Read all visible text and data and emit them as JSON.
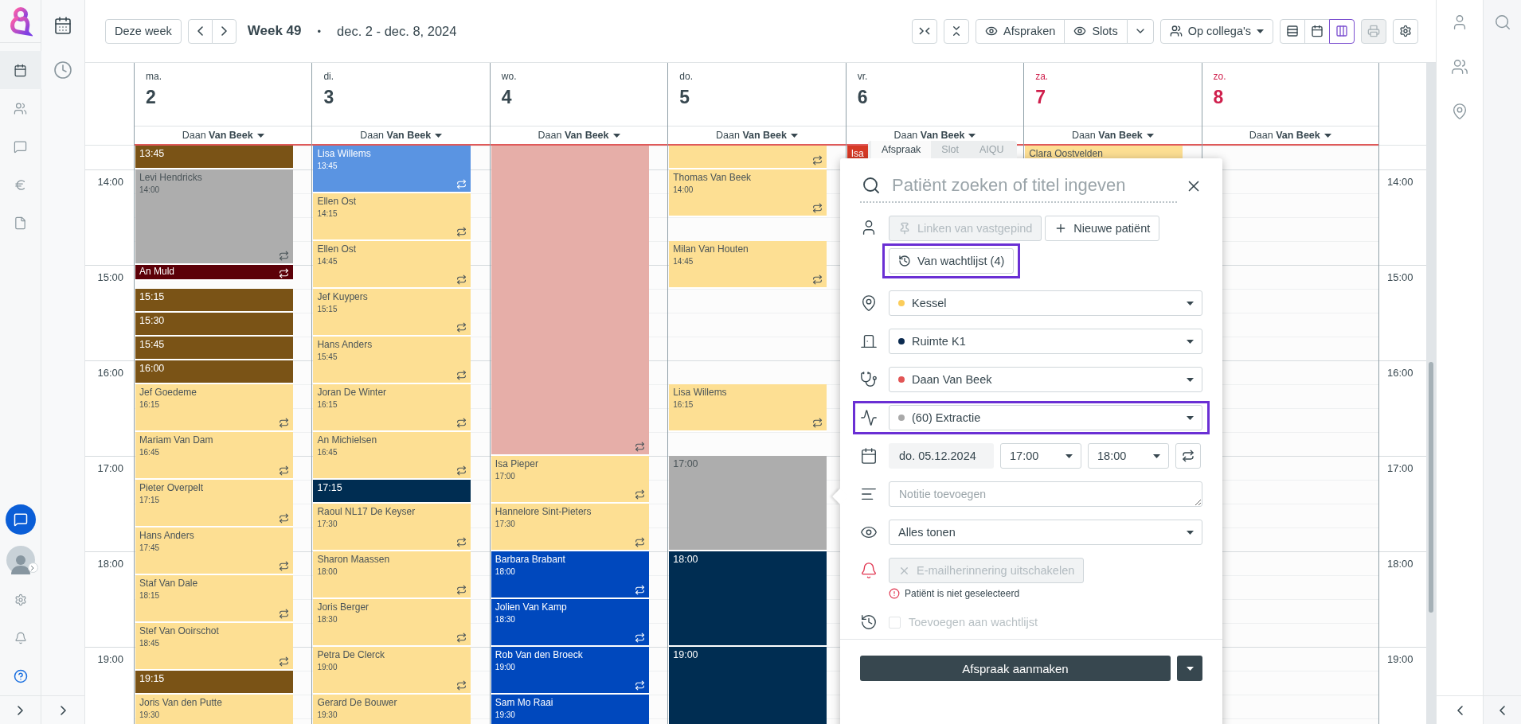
{
  "nav": {
    "items": [
      {
        "selected": true
      },
      {
        "selected": false
      },
      {
        "selected": false
      },
      {
        "selected": false
      },
      {
        "selected": false
      }
    ]
  },
  "subnav": {
    "items": [
      {
        "selected": true
      },
      {
        "selected": false
      }
    ]
  },
  "toolbar": {
    "today": "Deze week",
    "week": "Week 49",
    "separator": "•",
    "range": "dec. 2 - dec. 8, 2024",
    "show_toggles": [
      {
        "label": "Afspraken",
        "on": true
      },
      {
        "label": "Slots",
        "on": true
      }
    ],
    "colleagues": "Op collega's",
    "views": [
      {
        "selected": false
      },
      {
        "selected": false
      },
      {
        "selected": true
      }
    ],
    "print_disabled": true
  },
  "times_left": [
    "14:00",
    "15:00",
    "16:00",
    "17:00",
    "18:00",
    "19:00"
  ],
  "times_right": [
    "14:00",
    "15:00",
    "16:00",
    "17:00",
    "18:00",
    "19:00"
  ],
  "days": [
    {
      "name": "ma.",
      "date": "2",
      "weekend": false,
      "doctor": "Daan **Van Beek**",
      "events": [
        {
          "kind": "quarter-block",
          "time": "13:45",
          "color": "#7a5316",
          "repeat": false
        },
        {
          "kind": "hour-appointment",
          "name": "Levi Hendricks",
          "time": "14:00",
          "color": "#adadad",
          "repeat": true
        },
        {
          "kind": "short-appointment",
          "name": "An Muld",
          "color": "#5c0008",
          "repeat": true
        },
        {
          "kind": "quarter-block",
          "time": "15:15",
          "color": "#7a5316",
          "repeat": false
        },
        {
          "kind": "quarter-block",
          "time": "15:30",
          "color": "#7a5316",
          "repeat": false
        },
        {
          "kind": "quarter-block",
          "time": "15:45",
          "color": "#7a5316",
          "repeat": false
        },
        {
          "kind": "quarter-block",
          "time": "16:00",
          "color": "#7a5316",
          "repeat": false
        },
        {
          "kind": "appointment",
          "name": "Jef Goedeme",
          "time": "16:15",
          "color": "#fddf93",
          "repeat": true
        },
        {
          "kind": "appointment",
          "name": "Mariam Van Dam",
          "time": "16:45",
          "color": "#fddf93",
          "repeat": true
        },
        {
          "kind": "appointment",
          "name": "Pieter Overpelt",
          "time": "17:15",
          "color": "#fddf93",
          "repeat": true
        },
        {
          "kind": "appointment",
          "name": "Hans Anders",
          "time": "17:45",
          "color": "#fddf93",
          "repeat": true
        },
        {
          "kind": "appointment",
          "name": "Staf Van Dale",
          "time": "18:15",
          "color": "#fddf93",
          "repeat": true
        },
        {
          "kind": "appointment",
          "name": "Stef Van Ooirschot",
          "time": "18:45",
          "color": "#fddf93",
          "repeat": true
        },
        {
          "kind": "quarter-block",
          "time": "19:15",
          "color": "#7a5316",
          "repeat": false
        },
        {
          "kind": "appointment",
          "name": "Joris Van den Putte",
          "time": "19:30",
          "color": "#fddf93"
        }
      ]
    },
    {
      "name": "di.",
      "date": "3",
      "weekend": false,
      "doctor": "Daan **Van Beek**",
      "events": [
        {
          "kind": "appointment",
          "name": "Lisa Willems",
          "time": "13:45",
          "color": "#5a94e2",
          "repeat": true
        },
        {
          "kind": "appointment",
          "name": "Ellen Ost",
          "time": "14:15",
          "color": "#fddf93",
          "repeat": true
        },
        {
          "kind": "appointment",
          "name": "Ellen Ost",
          "time": "14:45",
          "color": "#fddf93",
          "repeat": true
        },
        {
          "kind": "appointment",
          "name": "Jef Kuypers",
          "time": "15:15",
          "color": "#fddf93",
          "repeat": true
        },
        {
          "kind": "appointment",
          "name": "Hans Anders",
          "time": "15:45",
          "color": "#fddf93",
          "repeat": true
        },
        {
          "kind": "appointment",
          "name": "Joran De Winter",
          "time": "16:15",
          "color": "#fddf93",
          "repeat": true
        },
        {
          "kind": "appointment",
          "name": "An Michielsen",
          "time": "16:45",
          "color": "#fddf93",
          "repeat": true
        },
        {
          "kind": "quarter-block",
          "time": "17:15",
          "color": "#002d52",
          "repeat": false
        },
        {
          "kind": "appointment",
          "name": "Raoul NL17 De Keyser",
          "time": "17:30",
          "color": "#fddf93",
          "repeat": true
        },
        {
          "kind": "appointment",
          "name": "Sharon Maassen",
          "time": "18:00",
          "color": "#fddf93",
          "repeat": true
        },
        {
          "kind": "appointment",
          "name": "Joris Berger",
          "time": "18:30",
          "color": "#fddf93",
          "repeat": true
        },
        {
          "kind": "appointment",
          "name": "Petra De Clerck",
          "time": "19:00",
          "color": "#fddf93",
          "repeat": true
        },
        {
          "kind": "appointment",
          "name": "Gerard De Bouwer",
          "time": "19:30",
          "color": "#fddf93"
        }
      ]
    },
    {
      "name": "wo.",
      "date": "4",
      "weekend": false,
      "doctor": "Daan **Van Beek**",
      "events": [
        {
          "kind": "reserved",
          "color": "#e6aea8",
          "repeat": true
        },
        {
          "kind": "appointment",
          "name": "Isa Pieper",
          "time": "17:00",
          "color": "#fddf93",
          "repeat": true
        },
        {
          "kind": "appointment",
          "name": "Hannelore Sint-Pieters",
          "time": "17:30",
          "color": "#fddf93",
          "repeat": true
        },
        {
          "kind": "appointment",
          "name": "Barbara Brabant",
          "time": "18:00",
          "color": "#0048bd",
          "repeat": true
        },
        {
          "kind": "appointment",
          "name": "Jolien Van Kamp",
          "time": "18:30",
          "color": "#0048bd",
          "repeat": true
        },
        {
          "kind": "appointment",
          "name": "Rob Van den Broeck",
          "time": "19:00",
          "color": "#0048bd",
          "repeat": true
        },
        {
          "kind": "appointment",
          "name": "Sam Mo Raai",
          "time": "19:30",
          "color": "#0048bd"
        }
      ]
    },
    {
      "name": "do.",
      "date": "5",
      "weekend": false,
      "doctor": "Daan **Van Beek**",
      "events": [
        {
          "kind": "quarter-appointment",
          "color": "#fddf93",
          "repeat": true
        },
        {
          "kind": "appointment",
          "name": "Thomas Van Beek",
          "time": "14:00",
          "color": "#fddf93",
          "repeat": true
        },
        {
          "kind": "gap"
        },
        {
          "kind": "appointment",
          "name": "Milan Van Houten",
          "time": "14:45",
          "color": "#fddf93",
          "repeat": true
        },
        {
          "kind": "hour-gap"
        },
        {
          "kind": "appointment",
          "name": "Lisa Willems",
          "time": "16:15",
          "color": "#fddf93",
          "repeat": true
        },
        {
          "kind": "gap"
        },
        {
          "kind": "hour-block",
          "time": "17:00",
          "color": "#adadad",
          "repeat": false
        },
        {
          "kind": "hour-block",
          "time": "18:00",
          "color": "#002d52",
          "repeat": false
        },
        {
          "kind": "hour-block",
          "time": "19:00",
          "color": "#002d52"
        }
      ]
    },
    {
      "name": "vr.",
      "date": "6",
      "weekend": false,
      "doctor": "Daan **Van Beek**",
      "events": [
        {
          "kind": "appointment",
          "name": "Isa",
          "color": "#d63a26"
        }
      ]
    },
    {
      "name": "za.",
      "date": "7",
      "weekend": true,
      "doctor": "Daan **Van Beek**",
      "events": [
        {
          "kind": "appointment",
          "name": "Clara Oostvelden",
          "color": "#fddf93"
        }
      ]
    },
    {
      "name": "zo.",
      "date": "8",
      "weekend": true,
      "doctor": "Daan **Van Beek**"
    }
  ],
  "popup": {
    "tabs": [
      {
        "label": "Afspraak",
        "selected": true
      },
      {
        "label": "Slot",
        "selected": false
      },
      {
        "label": "AIQU",
        "selected": false
      }
    ],
    "search_placeholder": "Patiënt zoeken of titel ingeven",
    "patient_buttons": [
      {
        "label": "Linken van vastgepind",
        "disabled": true,
        "highlighted": false
      },
      {
        "label": "Nieuwe patiënt",
        "disabled": false,
        "highlighted": false
      },
      {
        "label": "Van wachtlijst (4)",
        "disabled": false,
        "highlighted": true
      }
    ],
    "selects": [
      {
        "value": "Kessel",
        "color": "#fbcd5b",
        "highlighted": false
      },
      {
        "value": "Ruimte K1",
        "color": "#0b2a4f",
        "highlighted": false
      },
      {
        "value": "Daan Van Beek",
        "color": "#e25555",
        "highlighted": false
      },
      {
        "value": "(60) Extractie",
        "color": "#a9a9a9",
        "highlighted": true
      }
    ],
    "date": "do. 05.12.2024",
    "start": "17:00",
    "end": "18:00",
    "note_placeholder": "Notitie toevoegen",
    "visibility": "Alles tonen",
    "reminder": {
      "label": "E-mailherinnering uitschakelen",
      "disabled": true
    },
    "warning": "Patiënt is niet geselecteerd",
    "waitlist": {
      "label": "Toevoegen aan wachtlijst",
      "checked": false,
      "disabled": true
    },
    "submit": "Afspraak aanmaken"
  }
}
